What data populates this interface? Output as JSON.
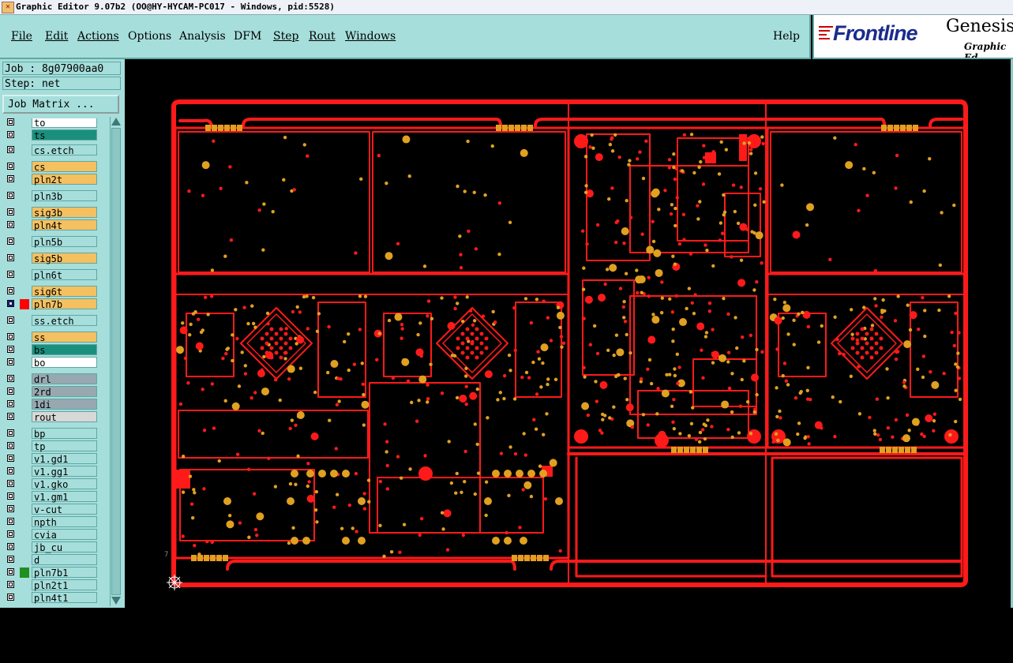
{
  "window": {
    "title": "Graphic Editor 9.07b2 (OO@HY-HYCAM-PC017 - Windows, pid:5528)"
  },
  "menu": {
    "items": [
      "File",
      "Edit",
      "Actions",
      "Options",
      "Analysis",
      "DFM",
      "Step",
      "Rout",
      "Windows"
    ],
    "help": "Help"
  },
  "brand": {
    "logo": "Frontline",
    "product": "Genesis",
    "subtitle": "Graphic Ed"
  },
  "job": {
    "job_line": "Job : 8g07900aa0",
    "step_line": "Step: net",
    "matrix_button": "Job Matrix ..."
  },
  "layers": [
    {
      "name": "to",
      "fill": "#ffffff",
      "swatch": ""
    },
    {
      "name": "ts",
      "fill": "#1a8f7d",
      "swatch": ""
    },
    {
      "name": "cs.etch",
      "fill": "#a6dedb",
      "swatch": ""
    },
    {
      "name": "cs",
      "fill": "#f5c060",
      "swatch": ""
    },
    {
      "name": "pln2t",
      "fill": "#f5c060",
      "swatch": ""
    },
    {
      "name": "pln3b",
      "fill": "#a6dedb",
      "swatch": ""
    },
    {
      "name": "sig3b",
      "fill": "#f5c060",
      "swatch": ""
    },
    {
      "name": "pln4t",
      "fill": "#f5c060",
      "swatch": ""
    },
    {
      "name": "pln5b",
      "fill": "#a6dedb",
      "swatch": ""
    },
    {
      "name": "sig5b",
      "fill": "#f5c060",
      "swatch": ""
    },
    {
      "name": "pln6t",
      "fill": "#a6dedb",
      "swatch": ""
    },
    {
      "name": "sig6t",
      "fill": "#f5c060",
      "swatch": ""
    },
    {
      "name": "pln7b",
      "fill": "#f5c060",
      "swatch": "#ff0000",
      "active": true
    },
    {
      "name": "ss.etch",
      "fill": "#a6dedb",
      "swatch": ""
    },
    {
      "name": "ss",
      "fill": "#f5c060",
      "swatch": ""
    },
    {
      "name": "bs",
      "fill": "#1a8f7d",
      "swatch": ""
    },
    {
      "name": "bo",
      "fill": "#ffffff",
      "swatch": ""
    },
    {
      "name": "drl",
      "fill": "#98a8b0",
      "swatch": ""
    },
    {
      "name": "2rd",
      "fill": "#98a8b0",
      "swatch": ""
    },
    {
      "name": "1di",
      "fill": "#98a8b0",
      "swatch": ""
    },
    {
      "name": "rout",
      "fill": "#d8d8d8",
      "swatch": ""
    },
    {
      "name": "bp",
      "fill": "#a6dedb",
      "swatch": ""
    },
    {
      "name": "tp",
      "fill": "#a6dedb",
      "swatch": ""
    },
    {
      "name": "v1.gd1",
      "fill": "#a6dedb",
      "swatch": ""
    },
    {
      "name": "v1.gg1",
      "fill": "#a6dedb",
      "swatch": ""
    },
    {
      "name": "v1.gko",
      "fill": "#a6dedb",
      "swatch": ""
    },
    {
      "name": "v1.gm1",
      "fill": "#a6dedb",
      "swatch": ""
    },
    {
      "name": "v-cut",
      "fill": "#a6dedb",
      "swatch": ""
    },
    {
      "name": "npth",
      "fill": "#a6dedb",
      "swatch": ""
    },
    {
      "name": "cvia",
      "fill": "#a6dedb",
      "swatch": ""
    },
    {
      "name": "jb_cu",
      "fill": "#a6dedb",
      "swatch": ""
    },
    {
      "name": "d",
      "fill": "#a6dedb",
      "swatch": ""
    },
    {
      "name": "pln7b1",
      "fill": "#a6dedb",
      "swatch": "#1f8f1f"
    },
    {
      "name": "pln2t1",
      "fill": "#a6dedb",
      "swatch": ""
    },
    {
      "name": "pln4t1",
      "fill": "#a6dedb",
      "swatch": ""
    }
  ],
  "colors": {
    "trace": "#ff1a1a",
    "pad": "#e0a020",
    "panel": "#a6dedb"
  },
  "canvas": {
    "marker": "7"
  }
}
